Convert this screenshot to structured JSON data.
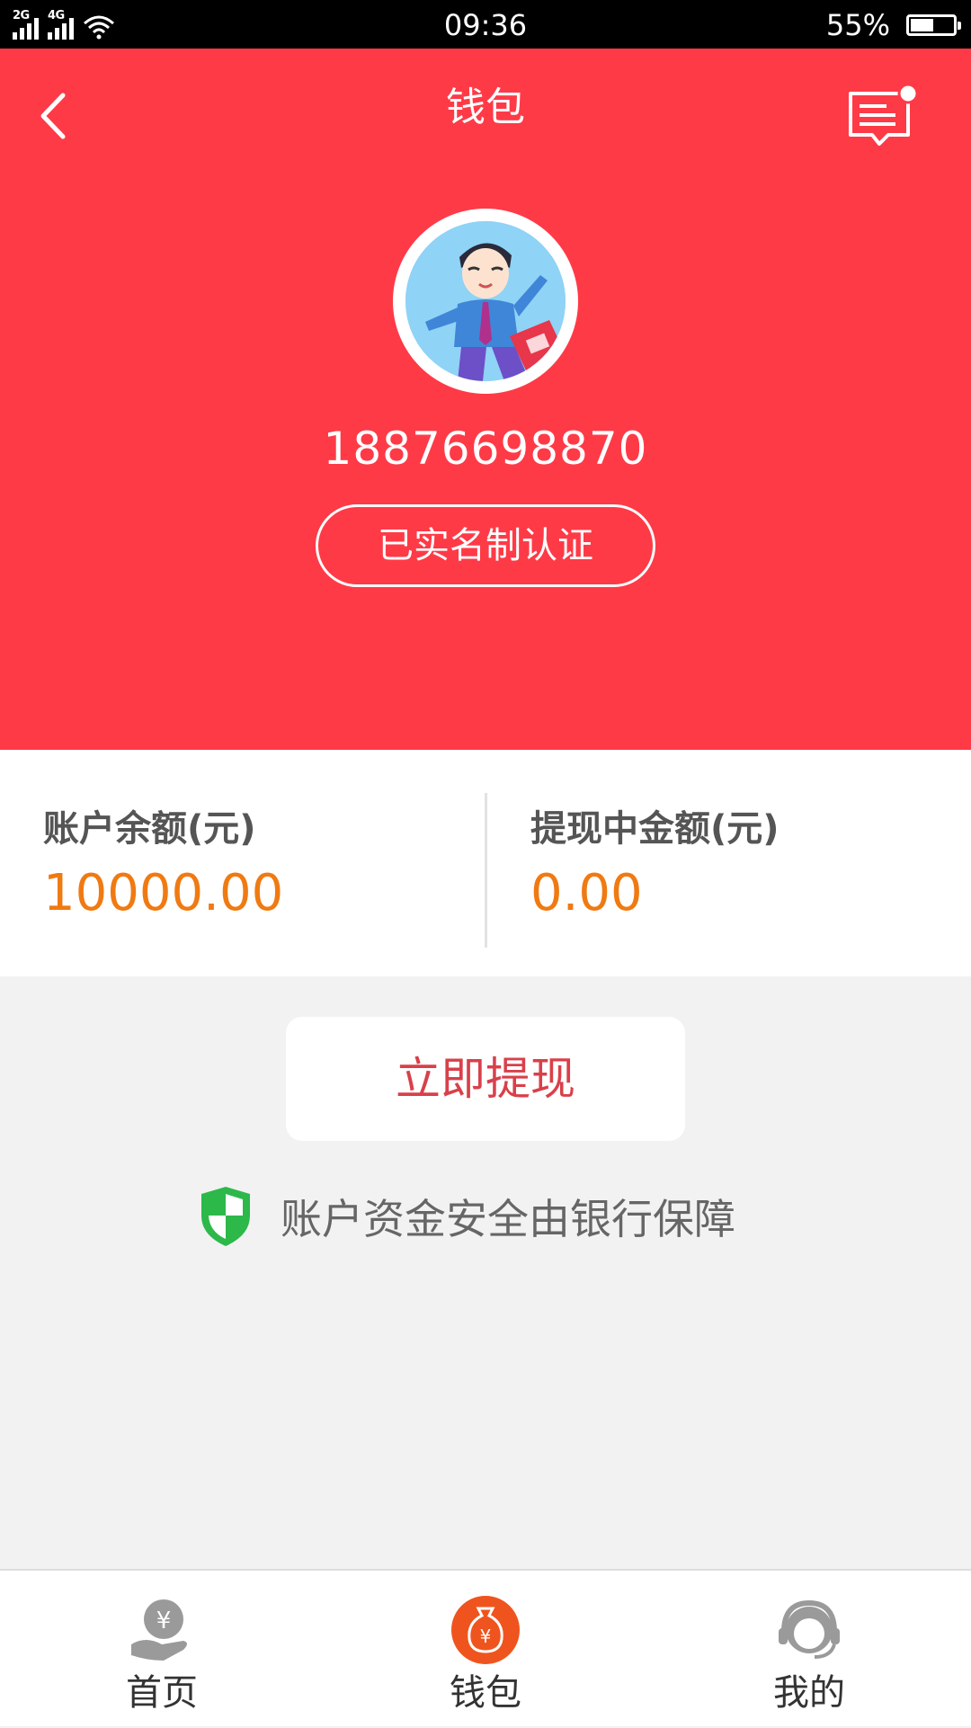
{
  "status_bar": {
    "network_1": "2G",
    "network_2": "4G",
    "time": "09:36",
    "battery_percent": "55%",
    "battery_level": 0.55
  },
  "header": {
    "title": "钱包",
    "back_icon": "chevron-left-icon",
    "message_icon": "message-icon",
    "background_color": "#ff3a47"
  },
  "profile": {
    "phone": "18876698870",
    "verify_label": "已实名制认证"
  },
  "balance": {
    "account_label": "账户余额(元)",
    "account_value": "10000.00",
    "pending_label": "提现中金额(元)",
    "pending_value": "0.00",
    "value_color": "#f07a12"
  },
  "actions": {
    "withdraw_label": "立即提现"
  },
  "security": {
    "text": "账户资金安全由银行保障",
    "icon": "shield-icon"
  },
  "tabbar": {
    "items": [
      {
        "label": "首页",
        "icon": "hand-coin-icon",
        "active": false
      },
      {
        "label": "钱包",
        "icon": "money-bag-icon",
        "active": true
      },
      {
        "label": "我的",
        "icon": "customer-service-icon",
        "active": false
      }
    ]
  }
}
